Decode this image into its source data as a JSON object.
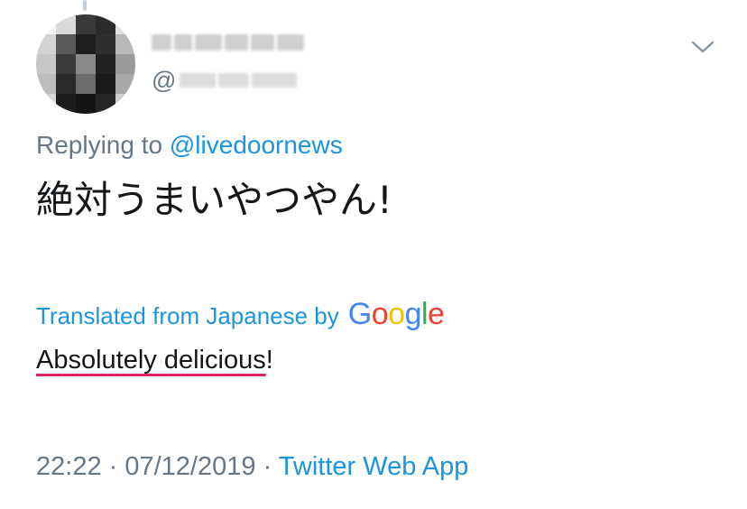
{
  "reply": {
    "prefix": "Replying to ",
    "mention": "@livedoornews"
  },
  "author": {
    "at_symbol": "@"
  },
  "tweet": {
    "text": "絶対うまいやつやん!"
  },
  "translation": {
    "label": "Translated from Japanese by",
    "provider": {
      "g1": "G",
      "o1": "o",
      "o2": "o",
      "g2": "g",
      "l": "l",
      "e": "e"
    },
    "text_underlined": "Absolutely delicious",
    "text_rest": "!"
  },
  "meta": {
    "time": "22:22",
    "separator1": " · ",
    "date": "07/12/2019",
    "separator2": " · ",
    "source": "Twitter Web App"
  },
  "colors": {
    "link": "#1b95e0",
    "secondary_text": "#657786",
    "primary_text": "#14171a",
    "spellcheck_underline": "#e0245e"
  },
  "icons": {
    "menu": "chevron-down-icon"
  }
}
